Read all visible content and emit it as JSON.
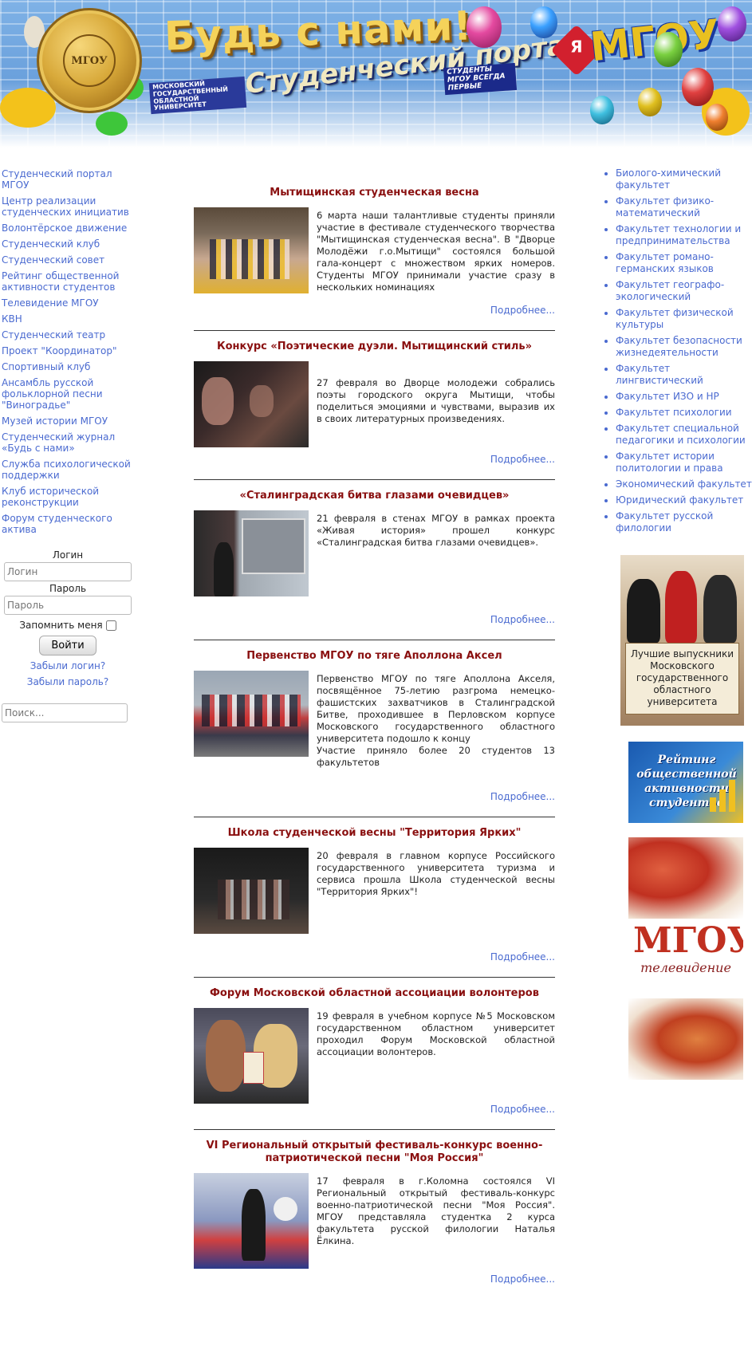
{
  "header": {
    "title": "Будь с нами!",
    "subtitle": "Студенческий портал",
    "university_badge": "МОСКОВСКИЙ ГОСУДАРСТВЕННЫЙ ОБЛАСТНОЙ УНИВЕРСИТЕТ",
    "motto": "СТУДЕНТЫ МГОУ ВСЕГДА ПЕРВЫЕ",
    "brand": "МГОУ",
    "heart_letter": "Я",
    "seal_text": "МГОУ"
  },
  "left_nav": [
    "Студенческий портал МГОУ",
    "Центр реализации студенческих инициатив",
    "Волонтёрское движение",
    "Студенческий клуб",
    "Студенческий совет",
    "Рейтинг общественной активности студентов",
    "Телевидение МГОУ",
    "КВН",
    "Студенческий театр",
    "Проект \"Координатор\"",
    "Спортивный клуб",
    "Ансамбль русской фольклорной песни \"Виноградье\"",
    "Музей истории МГОУ",
    "Студенческий журнал «Будь с нами»",
    "Служба психологической поддержки",
    "Клуб исторической реконструкции",
    "Форум студенческого актива"
  ],
  "login": {
    "login_label": "Логин",
    "login_placeholder": "Логин",
    "password_label": "Пароль",
    "password_placeholder": "Пароль",
    "remember_label": "Запомнить меня",
    "submit_label": "Войти",
    "forgot_login": "Забыли логин?",
    "forgot_password": "Забыли пароль?"
  },
  "search": {
    "placeholder": "Поиск..."
  },
  "news": [
    {
      "title": "Мытищинская студенческая весна",
      "text": "6 марта наши талантливые студенты приняли участие в фестивале студенческого творчества \"Мытищинская студенческая весна\". В \"Дворце Молодёжи г.о.Мытищи\" состоялся большой гала-концерт с множеством ярких номеров. Студенты МГОУ принимали участие сразу в нескольких номинациях",
      "more": "Подробнее..."
    },
    {
      "title": "Конкурс «Поэтические дуэли. Мытищинский стиль»",
      "text": "27 февраля во Дворце молодежи собрались поэты городского округа Мытищи, чтобы поделиться эмоциями и чувствами, выразив их в своих литературных произведениях.",
      "more": "Подробнее..."
    },
    {
      "title": "«Сталинградская битва глазами очевидцев»",
      "text": "21 февраля в стенах МГОУ в рамках проекта «Живая история» прошел конкурс «Сталинградская битва глазами очевидцев».",
      "more": "Подробнее..."
    },
    {
      "title": "Первенство МГОУ по тяге Аполлона Аксел",
      "text": "Первенство МГОУ по тяге Аполлона Акселя, посвящённое 75-летию разгрома немецко-фашистских захватчиков в Сталинградской Битве, проходившее в Перловском корпусе Московского государственного областного университета подошло к концу",
      "text2": "Участие приняло более 20 студентов 13 факультетов",
      "more": "Подробнее..."
    },
    {
      "title": "Школа студенческой весны \"Территория Ярких\"",
      "text": "20 февраля в главном корпусе Российского государственного университета туризма и сервиса прошла Школа студенческой весны \"Территория Ярких\"!",
      "more": "Подробнее..."
    },
    {
      "title": "Форум Московской областной ассоциации волонтеров",
      "text": "19 февраля в учебном корпусе №5 Московском государственном областном университет проходил Форум Московской областной ассоциации волонтеров.",
      "more": "Подробнее..."
    },
    {
      "title": "VI Региональный открытый фестиваль-конкурс военно-патриотической песни \"Моя Россия\"",
      "text": "17 февраля в г.Коломна состоялся VI Региональный открытый фестиваль-конкурс военно-патриотической песни \"Моя Россия\". МГОУ представляла студентка 2 курса факультета русской филологии Наталья Ёлкина.",
      "more": "Подробнее..."
    }
  ],
  "faculties": [
    "Биолого-химический факультет",
    "Факультет физико-математический",
    "Факультет технологии и предпринимательства",
    "Факультет романо-германских языков",
    "Факультет географо-экологический",
    "Факультет физической культуры",
    "Факультет безопасности жизнедеятельности",
    "Факультет лингвистический",
    "Факультет ИЗО и НР",
    "Факультет психологии",
    "Факультет специальной педагогики и психологии",
    "Факультет истории политологии и права",
    "Экономический факультет",
    "Юридический факультет",
    "Факультет русской филологии"
  ],
  "right_banners": {
    "graduates": "Лучшие выпускники Московского государственного областного университета",
    "rating": "Рейтинг общественной активности студентов",
    "tv_brand": "МГОУ",
    "tv_sub": "телевидение"
  },
  "colors": {
    "link": "#4a6ad0",
    "news_title": "#8a1010",
    "banner_sky": "#6aa0dc",
    "brand_gold": "#e8c020"
  }
}
